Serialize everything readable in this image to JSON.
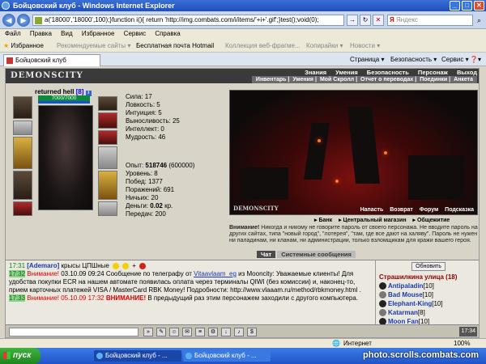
{
  "window": {
    "title": "Бойцовский клуб - Windows Internet Explorer"
  },
  "address_bar": {
    "url": "a('18000','18000',100);}function i(){ return 'http://img.combats.com/i/items/'+i+'.gif';}test();void(0);",
    "go": "→",
    "refresh": "↻",
    "stop": "✕",
    "search_placeholder": "Яндекс",
    "search_logo": "Я"
  },
  "menu": [
    "Файл",
    "Правка",
    "Вид",
    "Избранное",
    "Сервис",
    "Справка"
  ],
  "favorites_bar": {
    "favorites": "Избранное",
    "items": [
      "Рекомендуемые сайты ▾",
      "Бесплатная почта Hotmail",
      "Коллекция веб-фрагме...",
      "Копирайки ▾",
      "Новости ▾"
    ]
  },
  "tab": {
    "label": "Бойцовский клуб",
    "right_items": [
      "Страница ▾",
      "Безопасность ▾",
      "Сервис ▾",
      "❓▾"
    ]
  },
  "game": {
    "logo": "DEMONSCITY",
    "nav": [
      "Знания",
      "Умения",
      "Безопасность",
      "Персонаж",
      "Выход"
    ],
    "subnav": [
      "Инвентарь",
      "Умения",
      "Мой Скролл",
      "Отчет о переводах",
      "Поединки",
      "Анкета"
    ],
    "character": {
      "name": "returned hell",
      "level": "[8]",
      "info": "i",
      "hp_text": "7000/7000",
      "hp_fraction": 1.0
    },
    "stats": [
      "Сила: 17",
      "Ловкость: 5",
      "Интуиция: 5",
      "Выносливость: 25",
      "Интеллект: 0",
      "Мудрость: 46"
    ],
    "progress": {
      "exp_label": "Опыт: ",
      "exp_value": "518746",
      "exp_next": " (600000)",
      "level": "Уровень: 8",
      "wins": "Побед: 1377",
      "losses": "Поражений: 691",
      "draws": "Ничьих: 20",
      "money_label": "Деньги: ",
      "money_value": "0.02",
      "money_unit": " кр.",
      "transfers": "Передач: 200"
    },
    "scene": {
      "title": "DEMONSCITY",
      "nav": [
        "Напасть",
        "Возврат",
        "Форум",
        "Подсказка"
      ]
    },
    "links": [
      "▸ Банк",
      "▸ Центральный магазин",
      "▸ Общежитие"
    ],
    "warning": {
      "label": "Внимание!",
      "text": " Никогда и никому не говорите пароль от своего персонажа. Не вводите пароль на других сайтах, типа \"новый город\", \"лотерея\", \"там, где все дают на халяву\". Пароль не нужен ни паладинам, ни кланам, ни администрации, только взломщикам для кражи вашего героя."
    },
    "chat_tabs": [
      "Чат",
      "Системные сообщения"
    ],
    "chat": {
      "line1": {
        "time": "17:31",
        "nick": "[Ademaro]",
        "text": " крысы ЦПШные",
        "extra": "+"
      },
      "line2": {
        "time": "17:32",
        "label": "Внимание!",
        "text_a": " 03.10.09 09:24 Сообщение по телеграфу от ",
        "sender": "Vitaavlaam_eg",
        "text_b": " из Mooncity: Уважаемые клиенты! Для удобства покупки ECR на нашем автомате появилась оплата через терминалы QIWI (без комиссии) и, наконец-то, прием карточных платежей VISA / MasterCard RBK Money! Подробности: http://www.vlaaam.ru/method/rbkmoney.html ."
      },
      "line3": {
        "time": "17:33",
        "text_a": "Внимание! 05.10.09 17:32 ",
        "label": "ВНИМАНИЕ!",
        "text_b": " В предыдущий раз этим персонажем заходили с другого компьютера."
      }
    },
    "online": {
      "refresh": "Обновить",
      "location": "Страшилкина улица (18)",
      "users": [
        {
          "name": "Antipaladin",
          "level": "[10]"
        },
        {
          "name": "Bad Mouse",
          "level": "[10]"
        },
        {
          "name": "Elephant-King",
          "level": "[10]"
        },
        {
          "name": "Katarman",
          "level": "[8]"
        },
        {
          "name": "Moon Fan",
          "level": "[10]"
        }
      ]
    },
    "clock": "17:34"
  },
  "statusbar": {
    "internet": "Интернет",
    "zoom": "100%"
  },
  "taskbar": {
    "start": "пуск",
    "tasks": [
      "Бойцовский клуб - ...",
      "Бойцовский клуб - ..."
    ]
  },
  "watermark": "photo.scrolls.combats.com"
}
